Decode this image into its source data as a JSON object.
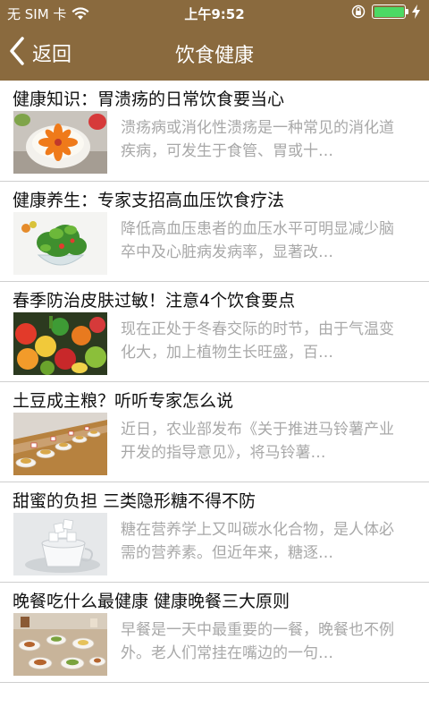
{
  "status_bar": {
    "carrier": "无 SIM 卡",
    "time": "上午9:52",
    "battery_level": 1.0,
    "battery_color": "#4cd964"
  },
  "nav": {
    "back_label": "返回",
    "title": "饮食健康",
    "bar_color": "#8a6a3e"
  },
  "articles": [
    {
      "title": "健康知识：胃溃疡的日常饮食要当心",
      "summary": "溃疡病或消化性溃疡是一种常见的消化道疾病，可发生于食管、胃或十…",
      "thumb_icon": "porridge-bowl-icon"
    },
    {
      "title": "健康养生：专家支招高血压饮食疗法",
      "summary": "降低高血压患者的血压水平可明显减少脑卒中及心脏病发病率，显著改…",
      "thumb_icon": "salad-bowl-icon"
    },
    {
      "title": "春季防治皮肤过敏！注意4个饮食要点",
      "summary": "现在正处于冬春交际的时节，由于气温变化大，加上植物生长旺盛，百…",
      "thumb_icon": "vegetables-icon"
    },
    {
      "title": "土豆成主粮？听听专家怎么说",
      "summary": "近日，农业部发布《关于推进马铃薯产业开发的指导意见》，将马铃薯…",
      "thumb_icon": "potato-dishes-icon"
    },
    {
      "title": "甜蜜的负担 三类隐形糖不得不防",
      "summary": "糖在营养学上又叫碳水化合物，是人体必需的营养素。但近年来，糖逐…",
      "thumb_icon": "sugar-cubes-icon"
    },
    {
      "title": "晚餐吃什么最健康 健康晚餐三大原则",
      "summary": "早餐是一天中最重要的一餐，晚餐也不例外。老人们常挂在嘴边的一句…",
      "thumb_icon": "dinner-table-icon"
    }
  ]
}
